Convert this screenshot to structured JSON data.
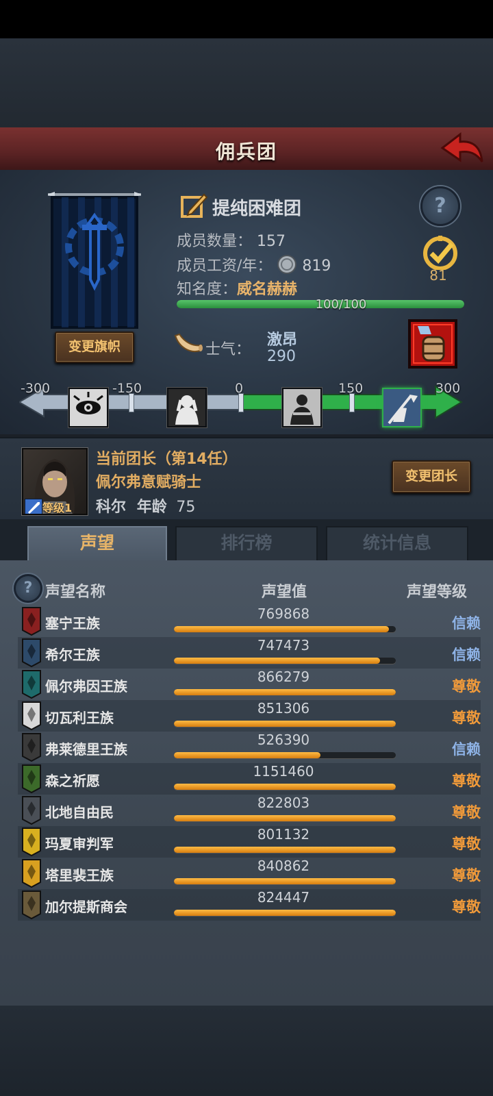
{
  "header": {
    "title": "佣兵团"
  },
  "company": {
    "name": "提纯困难团",
    "members_label": "成员数量：",
    "members": "157",
    "wage_label": "成员工资/年：",
    "wage": "819",
    "fame_label": "知名度：",
    "fame_rank": "威名赫赫",
    "fame_progress": "100/100",
    "fame_fraction": 1.0,
    "badge_count": "81",
    "change_banner": "变更旗帜"
  },
  "morale": {
    "label": "士气：",
    "state": "激昂",
    "value": "290",
    "scale": [
      "-300",
      "-150",
      "0",
      "150",
      "300"
    ],
    "colors": {
      "positive": "#2fb04a",
      "negative": "#a8b6c6"
    }
  },
  "leader": {
    "title": "当前团长（第14任）",
    "class": "佩尔弗意赋骑士",
    "name": "科尔",
    "age_label": "年龄",
    "age": "75",
    "level": "等级1",
    "change_button": "变更团长"
  },
  "tabs": [
    {
      "label": "声望",
      "active": true
    },
    {
      "label": "排行榜",
      "active": false
    },
    {
      "label": "统计信息",
      "active": false
    }
  ],
  "reputation": {
    "col_name": "声望名称",
    "col_value": "声望值",
    "col_level": "声望等级",
    "rows": [
      {
        "name": "塞宁王族",
        "value": "769868",
        "fill": 0.97,
        "level": "信赖",
        "level_color": "#8fb4e8",
        "icon_color": "#8a2020"
      },
      {
        "name": "希尔王族",
        "value": "747473",
        "fill": 0.93,
        "level": "信赖",
        "level_color": "#8fb4e8",
        "icon_color": "#2d4a6a"
      },
      {
        "name": "佩尔弗因王族",
        "value": "866279",
        "fill": 1.0,
        "level": "尊敬",
        "level_color": "#f09a3a",
        "icon_color": "#1e6b6b"
      },
      {
        "name": "切瓦利王族",
        "value": "851306",
        "fill": 1.0,
        "level": "尊敬",
        "level_color": "#f09a3a",
        "icon_color": "#d8d8d8"
      },
      {
        "name": "弗莱德里王族",
        "value": "526390",
        "fill": 0.66,
        "level": "信赖",
        "level_color": "#8fb4e8",
        "icon_color": "#3a3a3a"
      },
      {
        "name": "森之祈愿",
        "value": "1151460",
        "fill": 1.0,
        "level": "尊敬",
        "level_color": "#f09a3a",
        "icon_color": "#3c6a2a"
      },
      {
        "name": "北地自由民",
        "value": "822803",
        "fill": 1.0,
        "level": "尊敬",
        "level_color": "#f09a3a",
        "icon_color": "#4a4f56"
      },
      {
        "name": "玛夏审判军",
        "value": "801132",
        "fill": 1.0,
        "level": "尊敬",
        "level_color": "#f09a3a",
        "icon_color": "#d8b020"
      },
      {
        "name": "塔里裴王族",
        "value": "840862",
        "fill": 1.0,
        "level": "尊敬",
        "level_color": "#f09a3a",
        "icon_color": "#d8a020"
      },
      {
        "name": "加尔提斯商会",
        "value": "824447",
        "fill": 1.0,
        "level": "尊敬",
        "level_color": "#f09a3a",
        "icon_color": "#6a5a3a"
      }
    ]
  }
}
